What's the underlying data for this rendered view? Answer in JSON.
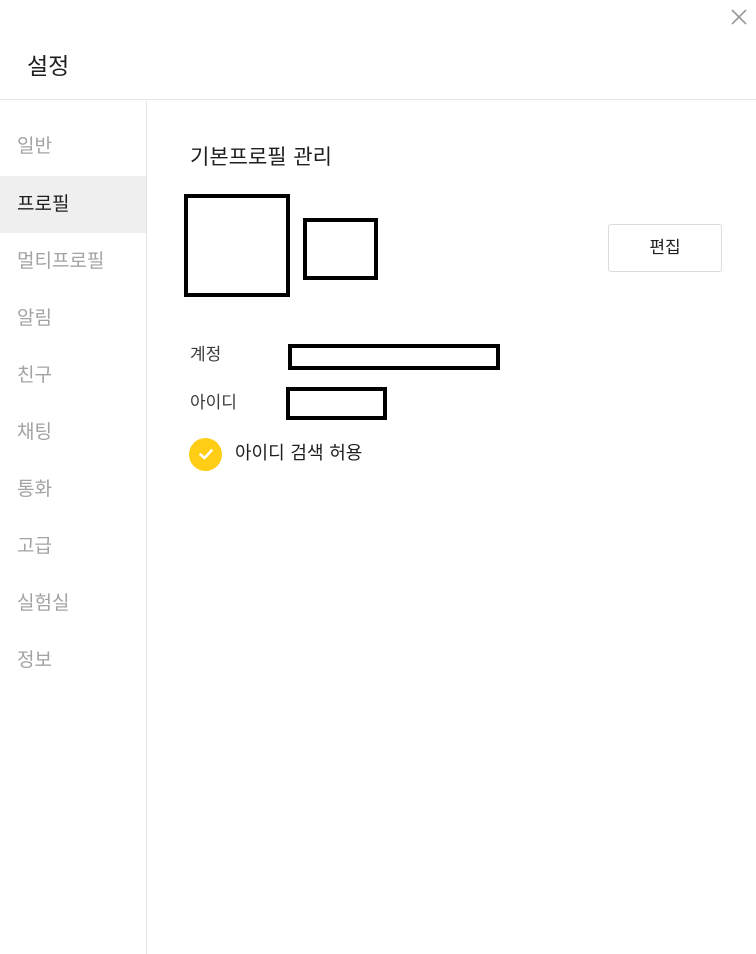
{
  "header": {
    "title": "설정"
  },
  "sidebar": {
    "items": [
      {
        "label": "일반"
      },
      {
        "label": "프로필"
      },
      {
        "label": "멀티프로필"
      },
      {
        "label": "알림"
      },
      {
        "label": "친구"
      },
      {
        "label": "채팅"
      },
      {
        "label": "통화"
      },
      {
        "label": "고급"
      },
      {
        "label": "실험실"
      },
      {
        "label": "정보"
      }
    ],
    "active_index": 1
  },
  "profile": {
    "section_title": "기본프로필 관리",
    "edit_label": "편집",
    "account_label": "계정",
    "id_label": "아이디",
    "id_search_label": "아이디 검색 허용",
    "id_search_checked": true
  },
  "colors": {
    "accent": "#ffcd14",
    "active_bg": "#efefef",
    "inactive_text": "#a3a3a3",
    "divider": "#e6e6e6"
  },
  "icons": {
    "close": "close-icon",
    "check": "check-icon"
  }
}
